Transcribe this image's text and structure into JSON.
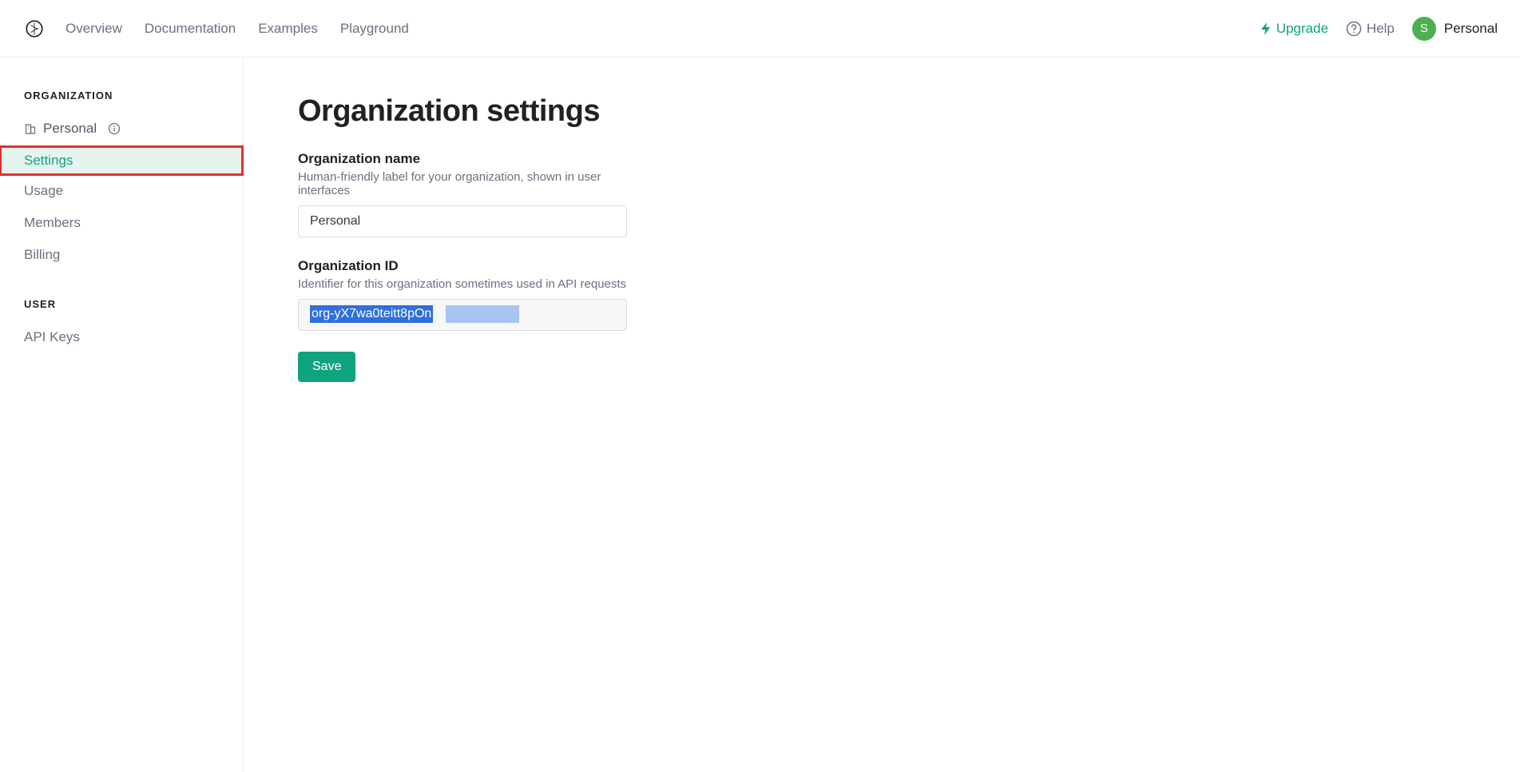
{
  "topnav": {
    "links": [
      "Overview",
      "Documentation",
      "Examples",
      "Playground"
    ],
    "upgrade": "Upgrade",
    "help": "Help",
    "account_label": "Personal",
    "avatar_initial": "S"
  },
  "sidebar": {
    "org_section": "ORGANIZATION",
    "org_name": "Personal",
    "items": [
      "Settings",
      "Usage",
      "Members",
      "Billing"
    ],
    "user_section": "USER",
    "user_items": [
      "API Keys"
    ]
  },
  "main": {
    "title": "Organization settings",
    "org_name_label": "Organization name",
    "org_name_desc": "Human-friendly label for your organization, shown in user interfaces",
    "org_name_value": "Personal",
    "org_id_label": "Organization ID",
    "org_id_desc": "Identifier for this organization sometimes used in API requests",
    "org_id_value": "org-yX7wa0teitt8pOn",
    "save_label": "Save"
  }
}
